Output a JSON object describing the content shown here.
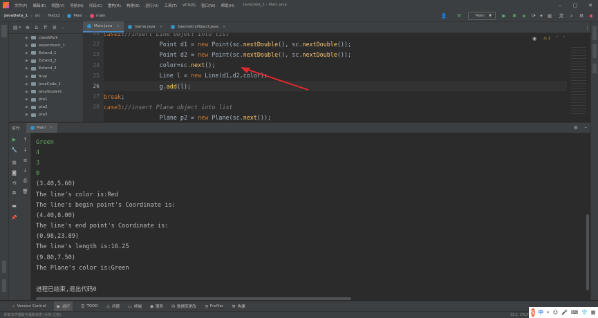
{
  "titlebar": {
    "menus": [
      "文件(F)",
      "编辑(E)",
      "视图(V)",
      "导航(N)",
      "代码(C)",
      "重构(R)",
      "构建(B)",
      "运行(U)",
      "工具(T)",
      "VCS(S)",
      "窗口(W)",
      "帮助(H)"
    ],
    "window_title": "JavaData_1 - Main.java"
  },
  "navbar": {
    "crumbs": [
      "JavaData_1",
      "src",
      "Test22",
      "Main",
      "main"
    ],
    "run_config": "Main"
  },
  "project_tree": [
    {
      "label": "classWork"
    },
    {
      "label": "experiment_1"
    },
    {
      "label": "Extend_1"
    },
    {
      "label": "Extend_2"
    },
    {
      "label": "Extend_3"
    },
    {
      "label": "final"
    },
    {
      "label": "JavaCode_1"
    },
    {
      "label": "JavaStudent"
    },
    {
      "label": "pta1"
    },
    {
      "label": "pta2"
    },
    {
      "label": "pta3"
    }
  ],
  "tabs": [
    {
      "label": "Main.java",
      "color": "#3592c4"
    },
    {
      "label": "Game.java",
      "color": "#3592c4"
    },
    {
      "label": "GeometryObject.java",
      "color": "#3592c4"
    }
  ],
  "editor": {
    "line_numbers": [
      "21",
      "22",
      "23",
      "24",
      "25",
      "26",
      "27",
      "28"
    ],
    "inspection_count": "1"
  },
  "run_panel": {
    "title": "运行:",
    "tab": "Main",
    "output": [
      {
        "text": "Green",
        "input": true
      },
      {
        "text": "4",
        "input": true
      },
      {
        "text": "3",
        "input": true
      },
      {
        "text": "0",
        "input": true
      },
      {
        "text": "(3.40,5.60)",
        "input": false
      },
      {
        "text": "The line's color is:Red",
        "input": false
      },
      {
        "text": "The line's begin point's Coordinate is:",
        "input": false
      },
      {
        "text": "(4.40,8.00)",
        "input": false
      },
      {
        "text": "The line's end point's Coordinate is:",
        "input": false
      },
      {
        "text": "(0.98,23.89)",
        "input": false
      },
      {
        "text": "The line's length is:16.25",
        "input": false
      },
      {
        "text": "(9.80,7.50)",
        "input": false
      },
      {
        "text": "The Plane's color is:Green",
        "input": false
      },
      {
        "text": "",
        "input": false
      },
      {
        "text": "进程已结束,退出代码0",
        "input": false
      }
    ]
  },
  "bottom_tabs": [
    {
      "label": "Version Control",
      "icon": "⑂"
    },
    {
      "label": "运行",
      "icon": "▶"
    },
    {
      "label": "TODO",
      "icon": "☰"
    },
    {
      "label": "问题",
      "icon": "⚠"
    },
    {
      "label": "终端",
      "icon": "▭"
    },
    {
      "label": "服务",
      "icon": "◉"
    },
    {
      "label": "数据库更改",
      "icon": "⛁"
    },
    {
      "label": "Profiler",
      "icon": "◔"
    },
    {
      "label": "构建",
      "icon": "⚒"
    }
  ],
  "status": {
    "message": "所有文件都处于最新状态 (片刻 之前)",
    "position": "32:1",
    "encoding": "CRLF"
  },
  "ime": {
    "lang": "中"
  },
  "colors": {
    "accent": "#4a88c7",
    "annotation_arrow": "#e0282e"
  }
}
